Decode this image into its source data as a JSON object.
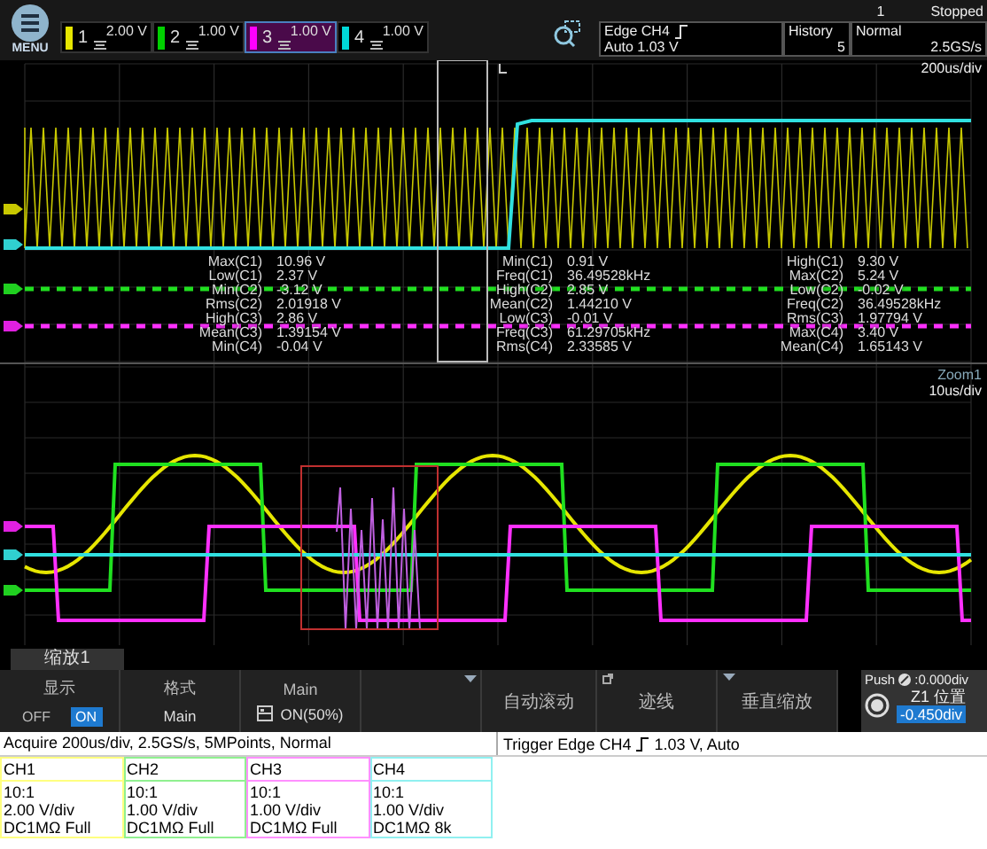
{
  "status": {
    "count": "1",
    "state": "Stopped"
  },
  "menu_label": "MENU",
  "channels": [
    {
      "number": "1",
      "scale": "2.00 V",
      "color": "#e6e600",
      "selected": false
    },
    {
      "number": "2",
      "scale": "1.00 V",
      "color": "#00d000",
      "selected": false
    },
    {
      "number": "3",
      "scale": "1.00 V",
      "color": "#ff00ff",
      "selected": true
    },
    {
      "number": "4",
      "scale": "1.00 V",
      "color": "#00d8d8",
      "selected": false
    }
  ],
  "trigger": {
    "source": "Edge CH4",
    "level": "Auto 1.03 V"
  },
  "history": {
    "label": "History",
    "value": "5"
  },
  "acquisition": {
    "mode": "Normal",
    "rate": "2.5GS/s"
  },
  "main_view": {
    "timebase": "200us/div",
    "measurements": [
      [
        {
          "label": "Max(C1)",
          "value": "10.96 V"
        },
        {
          "label": "Low(C1)",
          "value": "2.37 V"
        },
        {
          "label": "Min(C2)",
          "value": "-3.12 V"
        },
        {
          "label": "Rms(C2)",
          "value": "2.01918 V"
        },
        {
          "label": "High(C3)",
          "value": "2.86 V"
        },
        {
          "label": "Mean(C3)",
          "value": "1.39154 V"
        },
        {
          "label": "Min(C4)",
          "value": "-0.04 V"
        }
      ],
      [
        {
          "label": "Min(C1)",
          "value": "0.91 V"
        },
        {
          "label": "Freq(C1)",
          "value": "36.49528kHz"
        },
        {
          "label": "High(C2)",
          "value": "2.85 V"
        },
        {
          "label": "Mean(C2)",
          "value": "1.44210 V"
        },
        {
          "label": "Low(C3)",
          "value": "-0.01 V"
        },
        {
          "label": "Freq(C3)",
          "value": "61.29705kHz"
        },
        {
          "label": "Rms(C4)",
          "value": "2.33585 V"
        }
      ],
      [
        {
          "label": "High(C1)",
          "value": "9.30 V"
        },
        {
          "label": "Max(C2)",
          "value": "5.24 V"
        },
        {
          "label": "Low(C2)",
          "value": "-0.02 V"
        },
        {
          "label": "Freq(C2)",
          "value": "36.49528kHz"
        },
        {
          "label": "Rms(C3)",
          "value": "1.97794 V"
        },
        {
          "label": "Max(C4)",
          "value": "3.40 V"
        },
        {
          "label": "Mean(C4)",
          "value": "1.65143 V"
        }
      ]
    ]
  },
  "zoom_view": {
    "title": "Zoom1",
    "timebase": "10us/div"
  },
  "zoom_tab": "缩放1",
  "menu": [
    {
      "kind": "toggle",
      "label": "显示",
      "options": [
        {
          "label": "OFF",
          "selected": false
        },
        {
          "label": "ON",
          "selected": true
        }
      ]
    },
    {
      "kind": "value",
      "label": "格式",
      "value": "Main"
    },
    {
      "kind": "icon-value",
      "label": "Main",
      "value": "ON(50%)"
    },
    {
      "kind": "dropdown"
    },
    {
      "kind": "action",
      "label": "自动滚动"
    },
    {
      "kind": "corner-action",
      "label": "迹线"
    },
    {
      "kind": "dropdown-action",
      "label": "垂直缩放"
    }
  ],
  "knob": {
    "push": "Push",
    "reading": ":0.000div",
    "label": "Z1 位置",
    "value": "-0.450div"
  },
  "info": {
    "acquire": "Acquire 200us/div, 2.5GS/s, 5MPoints, Normal",
    "trigger_prefix": "Trigger Edge CH4",
    "trigger_suffix": "1.03 V, Auto"
  },
  "channel_cards": [
    {
      "title": "CH1",
      "probe": "10:1",
      "scale": "2.00 V/div",
      "coupling": "DC1MΩ Full",
      "color": "#ffff80"
    },
    {
      "title": "CH2",
      "probe": "10:1",
      "scale": "1.00 V/div",
      "coupling": "DC1MΩ Full",
      "color": "#90f090"
    },
    {
      "title": "CH3",
      "probe": "10:1",
      "scale": "1.00 V/div",
      "coupling": "DC1MΩ Full",
      "color": "#ff90ff"
    },
    {
      "title": "CH4",
      "probe": "10:1",
      "scale": "1.00 V/div",
      "coupling": "DC1MΩ 8k",
      "color": "#90f0f0"
    }
  ]
}
